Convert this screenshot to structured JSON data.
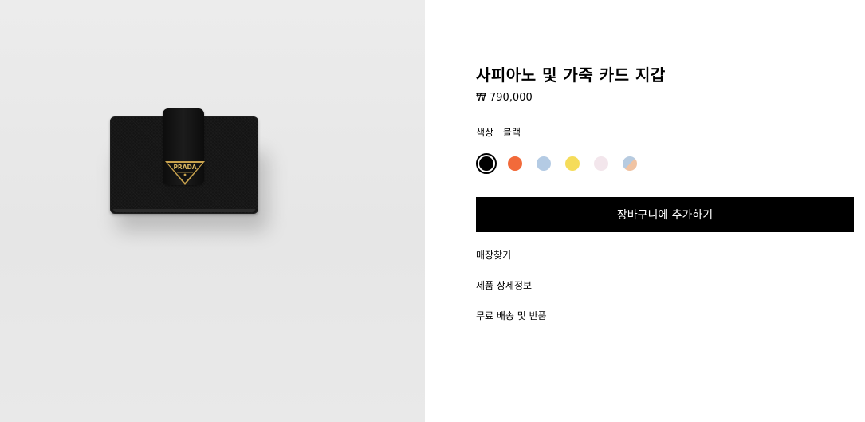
{
  "product": {
    "title": "사피아노 및 가죽 카드 지갑",
    "price": "₩ 790,000",
    "logo_text": "PRADA",
    "color_label": "색상",
    "color_value": "블랙"
  },
  "swatches": [
    {
      "name": "black",
      "color": "#000000",
      "selected": true
    },
    {
      "name": "orange",
      "color": "#f26a3a",
      "selected": false
    },
    {
      "name": "light-blue",
      "color": "#b4cbe4",
      "selected": false
    },
    {
      "name": "yellow",
      "color": "#f5dc5a",
      "selected": false
    },
    {
      "name": "pale-pink",
      "color": "#f3e6ec",
      "selected": false
    },
    {
      "name": "blue-peach",
      "color": "linear-gradient(135deg, #b7cbe0 50%, #f0c3a3 50%)",
      "selected": false
    }
  ],
  "actions": {
    "add_to_cart": "장바구니에 추가하기",
    "find_store": "매장찾기",
    "product_details": "제품 상세정보",
    "shipping_returns": "무료 배송 및 반품"
  }
}
